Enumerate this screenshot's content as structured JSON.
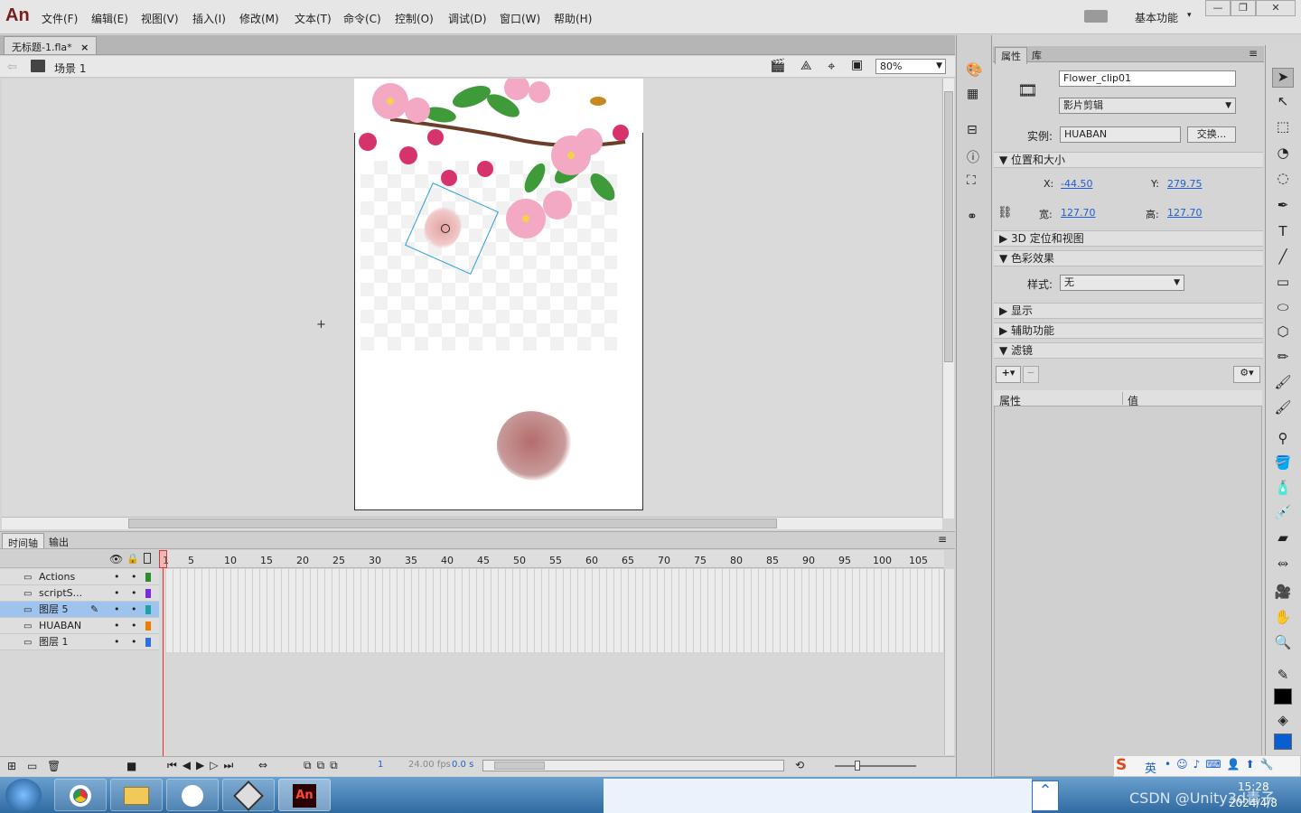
{
  "app": {
    "logo": "An"
  },
  "menu": [
    "文件(F)",
    "编辑(E)",
    "视图(V)",
    "插入(I)",
    "修改(M)",
    "文本(T)",
    "命令(C)",
    "控制(O)",
    "调试(D)",
    "窗口(W)",
    "帮助(H)"
  ],
  "workspace": {
    "label": "基本功能"
  },
  "document": {
    "tab": "无标题-1.fla*",
    "close": "×"
  },
  "scene": {
    "label": "场景 1",
    "zoom": "80%"
  },
  "timeline": {
    "tabs": [
      "时间轴",
      "输出"
    ],
    "ruler": [
      "1",
      "5",
      "10",
      "15",
      "20",
      "25",
      "30",
      "35",
      "40",
      "45",
      "50",
      "55",
      "60",
      "65",
      "70",
      "75",
      "80",
      "85",
      "90",
      "95",
      "100",
      "105"
    ],
    "layers": [
      {
        "name": "Actions",
        "color": "#2e8b2e"
      },
      {
        "name": "scriptS...",
        "color": "#7a2be0"
      },
      {
        "name": "图层 5",
        "color": "#1aa3a3"
      },
      {
        "name": "HUABAN",
        "color": "#f07a00"
      },
      {
        "name": "图层 1",
        "color": "#2d6fe0"
      }
    ],
    "frame": "1",
    "fps": "24.00 fps",
    "time": "0.0 s"
  },
  "properties": {
    "tabs": [
      "属性",
      "库"
    ],
    "instance_name": "Flower_clip01",
    "type": "影片剪辑",
    "instance_label": "实例:",
    "instance_value": "HUABAN",
    "swap": "交换...",
    "sections": {
      "position": "位置和大小",
      "3d": "3D 定位和视图",
      "color": "色彩效果",
      "display": "显示",
      "accessibility": "辅助功能",
      "filters": "滤镜"
    },
    "x_label": "X:",
    "x": "-44.50",
    "y_label": "Y:",
    "y": "279.75",
    "w_label": "宽:",
    "w": "127.70",
    "h_label": "高:",
    "h": "127.70",
    "style_label": "样式:",
    "style": "无",
    "filter_cols": [
      "属性",
      "值"
    ]
  },
  "tray": {
    "ime": "英",
    "time": "15:28",
    "date": "2024/4/8",
    "watermark": "CSDN @Unity3d青子"
  }
}
